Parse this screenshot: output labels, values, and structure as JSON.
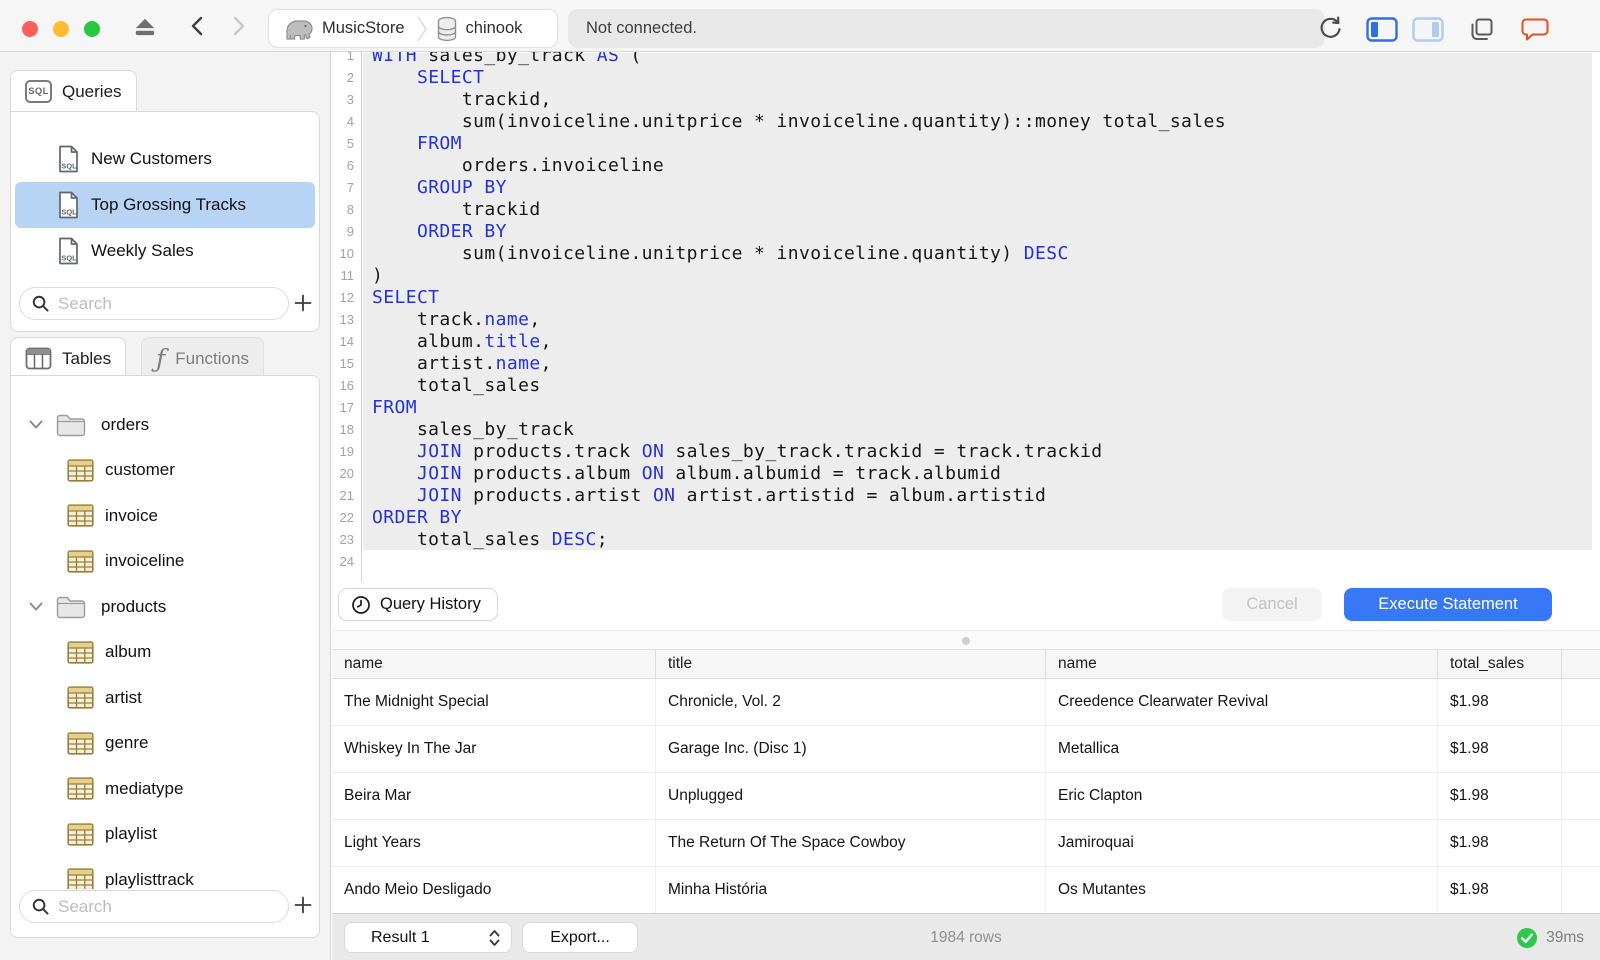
{
  "window": {
    "breadcrumb": {
      "server": "MusicStore",
      "database": "chinook"
    },
    "status": "Not connected.",
    "sql_badge": "SQL"
  },
  "sidebar": {
    "queries_tab": "Queries",
    "tables_tab": "Tables",
    "functions_tab": "Functions",
    "functions_glyph": "ƒ",
    "queries": [
      {
        "label": "New Customers",
        "selected": false
      },
      {
        "label": "Top Grossing Tracks",
        "selected": true
      },
      {
        "label": "Weekly Sales",
        "selected": false
      }
    ],
    "queries_search_placeholder": "Search",
    "tables_search_placeholder": "Search",
    "tree": [
      {
        "kind": "folder",
        "label": "orders",
        "expanded": true
      },
      {
        "kind": "table",
        "label": "customer"
      },
      {
        "kind": "table",
        "label": "invoice"
      },
      {
        "kind": "table",
        "label": "invoiceline"
      },
      {
        "kind": "folder",
        "label": "products",
        "expanded": true
      },
      {
        "kind": "table",
        "label": "album"
      },
      {
        "kind": "table",
        "label": "artist"
      },
      {
        "kind": "table",
        "label": "genre"
      },
      {
        "kind": "table",
        "label": "mediatype"
      },
      {
        "kind": "table",
        "label": "playlist"
      },
      {
        "kind": "table",
        "label": "playlisttrack"
      }
    ]
  },
  "editor": {
    "lines": [
      {
        "n": 1,
        "seg": [
          [
            "k",
            "WITH"
          ],
          [
            "p",
            " sales_by_track "
          ],
          [
            "k",
            "AS"
          ],
          [
            "p",
            " ("
          ]
        ]
      },
      {
        "n": 2,
        "seg": [
          [
            "p",
            "    "
          ],
          [
            "k",
            "SELECT"
          ]
        ]
      },
      {
        "n": 3,
        "seg": [
          [
            "p",
            "        trackid,"
          ]
        ]
      },
      {
        "n": 4,
        "seg": [
          [
            "p",
            "        sum(invoiceline.unitprice * invoiceline.quantity)::money total_sales"
          ]
        ]
      },
      {
        "n": 5,
        "seg": [
          [
            "p",
            "    "
          ],
          [
            "k",
            "FROM"
          ]
        ]
      },
      {
        "n": 6,
        "seg": [
          [
            "p",
            "        orders.invoiceline"
          ]
        ]
      },
      {
        "n": 7,
        "seg": [
          [
            "p",
            "    "
          ],
          [
            "k",
            "GROUP BY"
          ]
        ]
      },
      {
        "n": 8,
        "seg": [
          [
            "p",
            "        trackid"
          ]
        ]
      },
      {
        "n": 9,
        "seg": [
          [
            "p",
            "    "
          ],
          [
            "k",
            "ORDER BY"
          ]
        ]
      },
      {
        "n": 10,
        "seg": [
          [
            "p",
            "        sum(invoiceline.unitprice * invoiceline.quantity) "
          ],
          [
            "k",
            "DESC"
          ]
        ]
      },
      {
        "n": 11,
        "seg": [
          [
            "p",
            ")"
          ]
        ]
      },
      {
        "n": 12,
        "seg": [
          [
            "k",
            "SELECT"
          ]
        ]
      },
      {
        "n": 13,
        "seg": [
          [
            "p",
            "    track."
          ],
          [
            "k",
            "name"
          ],
          [
            "p",
            ","
          ]
        ]
      },
      {
        "n": 14,
        "seg": [
          [
            "p",
            "    album."
          ],
          [
            "k",
            "title"
          ],
          [
            "p",
            ","
          ]
        ]
      },
      {
        "n": 15,
        "seg": [
          [
            "p",
            "    artist."
          ],
          [
            "k",
            "name"
          ],
          [
            "p",
            ","
          ]
        ]
      },
      {
        "n": 16,
        "seg": [
          [
            "p",
            "    total_sales"
          ]
        ]
      },
      {
        "n": 17,
        "seg": [
          [
            "k",
            "FROM"
          ]
        ]
      },
      {
        "n": 18,
        "seg": [
          [
            "p",
            "    sales_by_track"
          ]
        ]
      },
      {
        "n": 19,
        "seg": [
          [
            "p",
            "    "
          ],
          [
            "k",
            "JOIN"
          ],
          [
            "p",
            " products.track "
          ],
          [
            "k",
            "ON"
          ],
          [
            "p",
            " sales_by_track.trackid = track.trackid"
          ]
        ]
      },
      {
        "n": 20,
        "seg": [
          [
            "p",
            "    "
          ],
          [
            "k",
            "JOIN"
          ],
          [
            "p",
            " products.album "
          ],
          [
            "k",
            "ON"
          ],
          [
            "p",
            " album.albumid = track.albumid"
          ]
        ]
      },
      {
        "n": 21,
        "seg": [
          [
            "p",
            "    "
          ],
          [
            "k",
            "JOIN"
          ],
          [
            "p",
            " products.artist "
          ],
          [
            "k",
            "ON"
          ],
          [
            "p",
            " artist.artistid = album.artistid"
          ]
        ]
      },
      {
        "n": 22,
        "seg": [
          [
            "k",
            "ORDER BY"
          ]
        ]
      },
      {
        "n": 23,
        "seg": [
          [
            "p",
            "    total_sales "
          ],
          [
            "k",
            "DESC"
          ],
          [
            "p",
            ";"
          ]
        ]
      },
      {
        "n": 24,
        "seg": []
      }
    ],
    "query_history_label": "Query History",
    "cancel_label": "Cancel",
    "execute_label": "Execute Statement"
  },
  "results": {
    "columns": [
      "name",
      "title",
      "name",
      "total_sales"
    ],
    "rows": [
      [
        "The Midnight Special",
        "Chronicle, Vol. 2",
        "Creedence Clearwater Revival",
        "$1.98"
      ],
      [
        "Whiskey In The Jar",
        "Garage Inc. (Disc 1)",
        "Metallica",
        "$1.98"
      ],
      [
        "Beira Mar",
        "Unplugged",
        "Eric Clapton",
        "$1.98"
      ],
      [
        "Light Years",
        "The Return Of The Space Cowboy",
        "Jamiroquai",
        "$1.98"
      ],
      [
        "Ando Meio Desligado",
        "Minha História",
        "Os Mutantes",
        "$1.98"
      ]
    ],
    "footer": {
      "result_selector": "Result 1",
      "export_label": "Export...",
      "row_count": "1984 rows",
      "duration": "39ms"
    }
  },
  "colors": {
    "accent_blue": "#3877f6",
    "selection_blue": "#b7d4f4",
    "keyword_blue": "#2432d9",
    "success_green": "#2fc84d",
    "chat_orange": "#e2521c"
  }
}
